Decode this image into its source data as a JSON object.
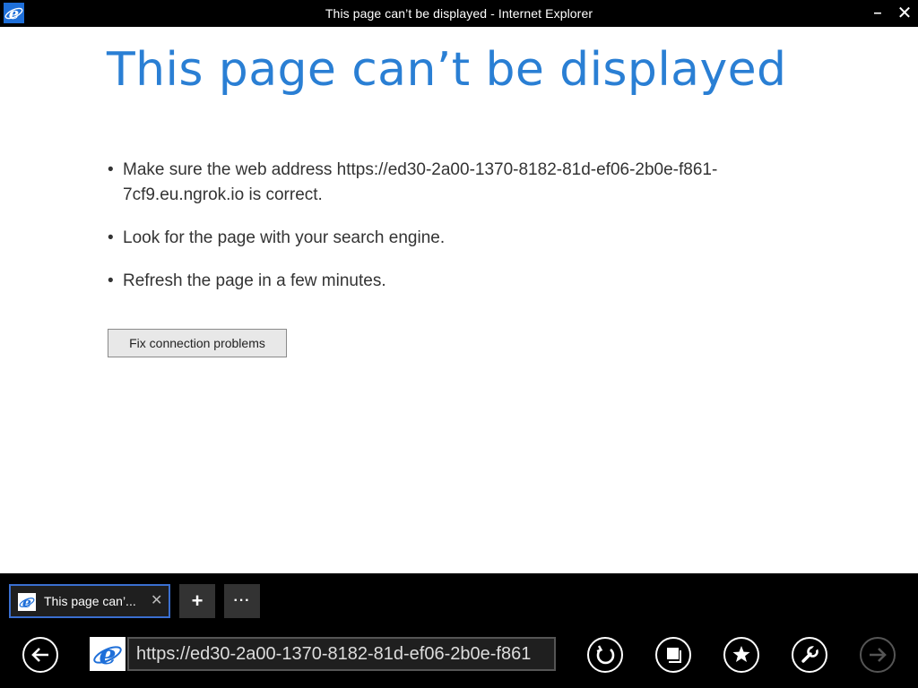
{
  "window": {
    "title": "This page can’t be displayed - Internet Explorer",
    "minimize_glyph": "–",
    "close_glyph": "✕"
  },
  "content": {
    "heading": "This page can’t be displayed",
    "tips": [
      "Make sure the web address https://ed30-2a00-1370-8182-81d-ef06-2b0e-f861-7cf9.eu.ngrok.io is correct.",
      "Look for the page with your search engine.",
      "Refresh the page in a few minutes."
    ],
    "bullet": "•",
    "fix_button_label": "Fix connection problems"
  },
  "appbar": {
    "tab": {
      "label": "This page can’...",
      "close_glyph": "✕"
    },
    "new_tab_glyph": "+",
    "more_glyph": "···",
    "address": "https://ed30-2a00-1370-8182-81d-ef06-2b0e-f861"
  },
  "icons": {
    "app": "internet-explorer-icon",
    "back": "back-arrow-icon",
    "refresh": "refresh-icon",
    "tabs": "tabs-icon",
    "favorites": "star-icon",
    "tools": "wrench-icon",
    "forward": "forward-arrow-icon"
  },
  "colors": {
    "heading": "#2a7fd4",
    "tab_border": "#3a6fd0",
    "ie_blue": "#1e6fd9",
    "bar_background": "#000000"
  }
}
